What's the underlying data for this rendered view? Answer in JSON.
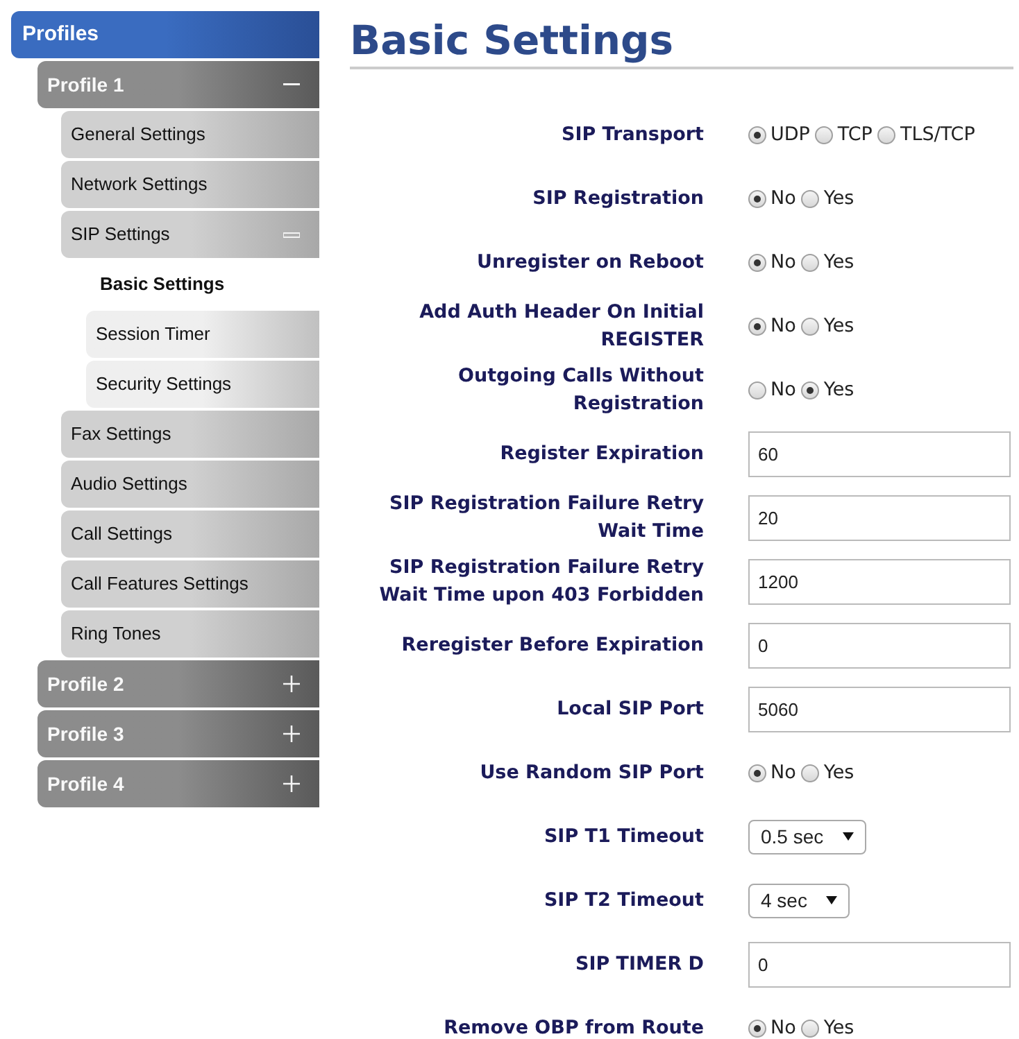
{
  "sidebar": {
    "title": "Profiles",
    "profiles": [
      {
        "label": "Profile 1",
        "expanded": true,
        "children": [
          {
            "label": "General Settings",
            "selected": false
          },
          {
            "label": "Network Settings",
            "selected": false
          },
          {
            "label": "SIP Settings",
            "selected": false,
            "expanded": true,
            "children": [
              {
                "label": "Basic Settings",
                "selected": true
              },
              {
                "label": "Session Timer",
                "selected": false
              },
              {
                "label": "Security Settings",
                "selected": false
              }
            ]
          },
          {
            "label": "Fax Settings",
            "selected": false
          },
          {
            "label": "Audio Settings",
            "selected": false
          },
          {
            "label": "Call Settings",
            "selected": false
          },
          {
            "label": "Call Features Settings",
            "selected": false
          },
          {
            "label": "Ring Tones",
            "selected": false
          }
        ]
      },
      {
        "label": "Profile 2",
        "expanded": false
      },
      {
        "label": "Profile 3",
        "expanded": false
      },
      {
        "label": "Profile 4",
        "expanded": false
      }
    ]
  },
  "page": {
    "title": "Basic Settings",
    "fields": [
      {
        "label": "SIP Transport",
        "kind": "radio",
        "options": [
          {
            "label": "UDP",
            "selected": true
          },
          {
            "label": "TCP",
            "selected": false
          },
          {
            "label": "TLS/TCP",
            "selected": false
          }
        ]
      },
      {
        "label": "SIP Registration",
        "kind": "radio",
        "options": [
          {
            "label": "No",
            "selected": true
          },
          {
            "label": "Yes",
            "selected": false
          }
        ]
      },
      {
        "label": "Unregister on Reboot",
        "kind": "radio",
        "options": [
          {
            "label": "No",
            "selected": true
          },
          {
            "label": "Yes",
            "selected": false
          }
        ]
      },
      {
        "label": "Add Auth Header On Initial REGISTER",
        "kind": "radio",
        "options": [
          {
            "label": "No",
            "selected": true
          },
          {
            "label": "Yes",
            "selected": false
          }
        ]
      },
      {
        "label": "Outgoing Calls Without Registration",
        "kind": "radio",
        "options": [
          {
            "label": "No",
            "selected": false
          },
          {
            "label": "Yes",
            "selected": true
          }
        ]
      },
      {
        "label": "Register Expiration",
        "kind": "text",
        "value": "60"
      },
      {
        "label": "SIP Registration Failure Retry Wait Time",
        "kind": "text",
        "value": "20"
      },
      {
        "label": "SIP Registration Failure Retry Wait Time upon 403 Forbidden",
        "kind": "text",
        "value": "1200"
      },
      {
        "label": "Reregister Before Expiration",
        "kind": "text",
        "value": "0"
      },
      {
        "label": "Local SIP Port",
        "kind": "text",
        "value": "5060"
      },
      {
        "label": "Use Random SIP Port",
        "kind": "radio",
        "options": [
          {
            "label": "No",
            "selected": true
          },
          {
            "label": "Yes",
            "selected": false
          }
        ]
      },
      {
        "label": "SIP T1 Timeout",
        "kind": "select",
        "value": "0.5 sec"
      },
      {
        "label": "SIP T2 Timeout",
        "kind": "select",
        "value": "4 sec"
      },
      {
        "label": "SIP TIMER D",
        "kind": "text",
        "value": "0"
      },
      {
        "label": "Remove OBP from Route",
        "kind": "radio",
        "options": [
          {
            "label": "No",
            "selected": true
          },
          {
            "label": "Yes",
            "selected": false
          }
        ]
      }
    ]
  }
}
